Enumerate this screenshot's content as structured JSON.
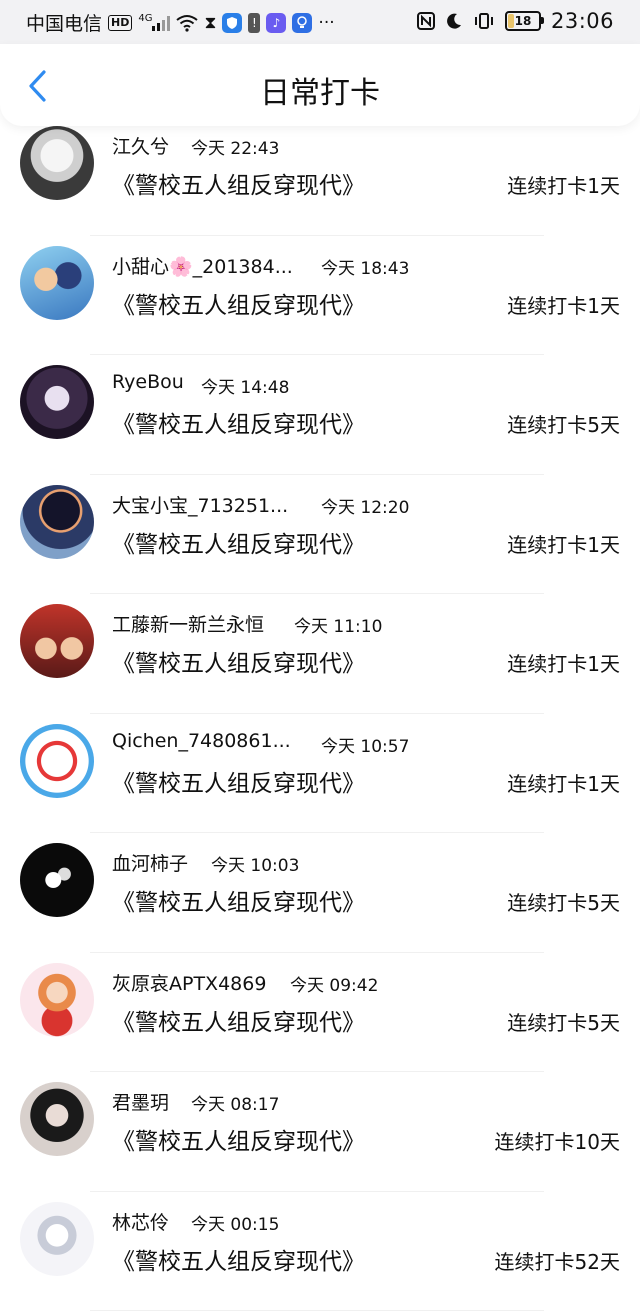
{
  "status_bar": {
    "carrier": "中国电信",
    "hd": "HD",
    "network": "4G",
    "battery": "18",
    "time": "23:06"
  },
  "header": {
    "title": "日常打卡"
  },
  "checkins": [
    {
      "name": "江久兮",
      "time": "今天 22:43",
      "book": "《警校五人组反穿现代》",
      "streak": "连续打卡1天"
    },
    {
      "name": "小甜心🌸_201384...",
      "time": "今天 18:43",
      "book": "《警校五人组反穿现代》",
      "streak": "连续打卡1天"
    },
    {
      "name": "RyeBou",
      "time": "今天 14:48",
      "book": "《警校五人组反穿现代》",
      "streak": "连续打卡5天"
    },
    {
      "name": "大宝小宝_713251...",
      "time": "今天 12:20",
      "book": "《警校五人组反穿现代》",
      "streak": "连续打卡1天"
    },
    {
      "name": "工藤新一新兰永恒",
      "time": "今天 11:10",
      "book": "《警校五人组反穿现代》",
      "streak": "连续打卡1天"
    },
    {
      "name": "Qichen_7480861...",
      "time": "今天 10:57",
      "book": "《警校五人组反穿现代》",
      "streak": "连续打卡1天"
    },
    {
      "name": "血河柿子",
      "time": "今天 10:03",
      "book": "《警校五人组反穿现代》",
      "streak": "连续打卡5天"
    },
    {
      "name": "灰原哀APTX4869",
      "time": "今天 09:42",
      "book": "《警校五人组反穿现代》",
      "streak": "连续打卡5天"
    },
    {
      "name": "君墨玥",
      "time": "今天 08:17",
      "book": "《警校五人组反穿现代》",
      "streak": "连续打卡10天"
    },
    {
      "name": "林芯伶",
      "time": "今天 00:15",
      "book": "《警校五人组反穿现代》",
      "streak": "连续打卡52天"
    }
  ],
  "colors": {
    "accent": "#2f8bf0",
    "status_bar_bg": "#f2f2f4"
  }
}
